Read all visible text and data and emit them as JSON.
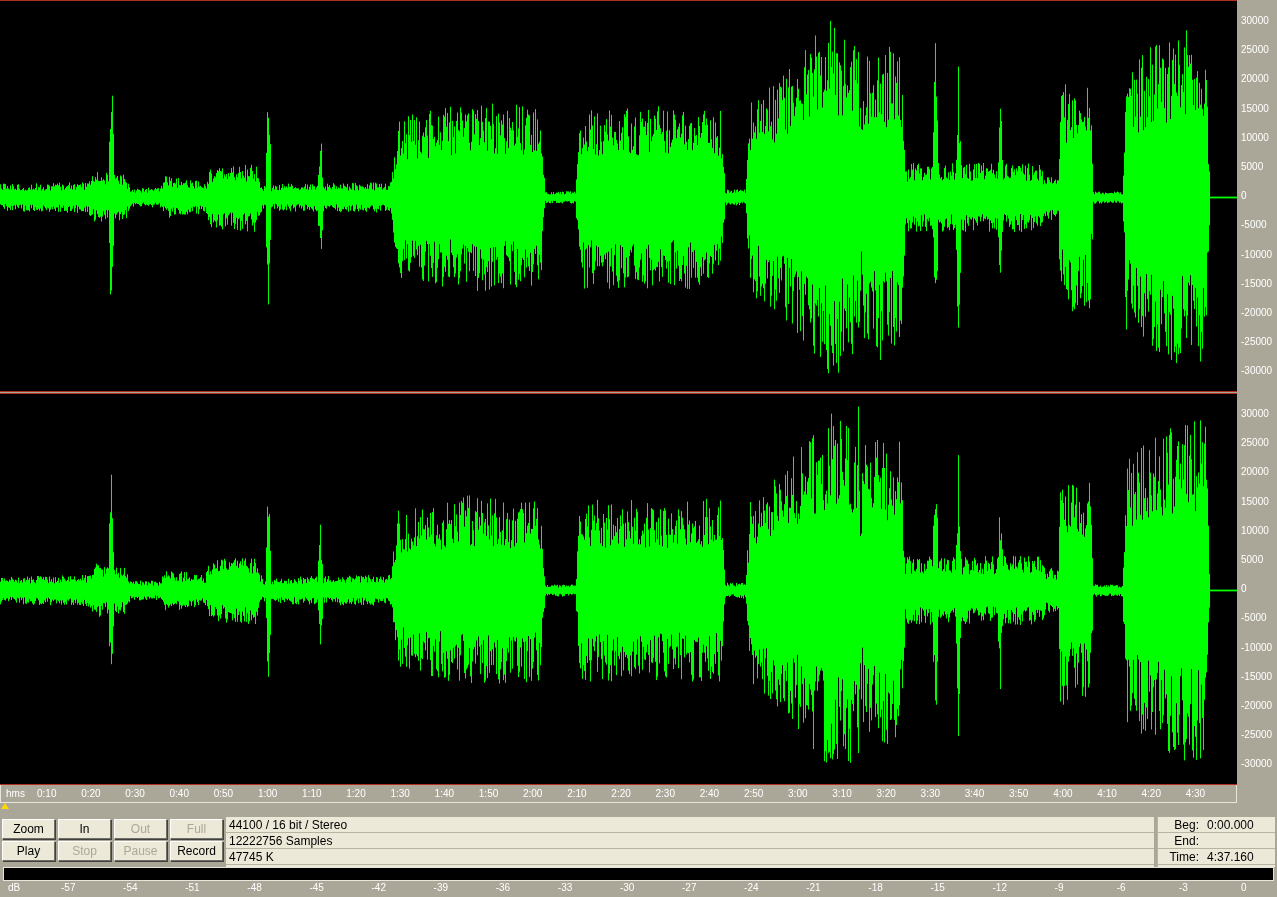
{
  "channels": [
    {
      "amplitude_ticks": [
        "30000",
        "25000",
        "20000",
        "15000",
        "10000",
        "5000",
        "0",
        "-5000",
        "-10000",
        "-15000",
        "-20000",
        "-25000",
        "-30000"
      ]
    },
    {
      "amplitude_ticks": [
        "30000",
        "25000",
        "20000",
        "15000",
        "10000",
        "5000",
        "0",
        "-5000",
        "-10000",
        "-15000",
        "-20000",
        "-25000",
        "-30000"
      ]
    }
  ],
  "time_ruler": {
    "unit": "hms",
    "ticks": [
      "0:10",
      "0:20",
      "0:30",
      "0:40",
      "0:50",
      "1:00",
      "1:10",
      "1:20",
      "1:30",
      "1:40",
      "1:50",
      "2:00",
      "2:10",
      "2:20",
      "2:30",
      "2:40",
      "2:50",
      "3:00",
      "3:10",
      "3:20",
      "3:30",
      "3:40",
      "3:50",
      "4:00",
      "4:10",
      "4:20",
      "4:30"
    ]
  },
  "transport_buttons": [
    {
      "label": "Zoom",
      "disabled": false
    },
    {
      "label": "In",
      "disabled": false
    },
    {
      "label": "Out",
      "disabled": true
    },
    {
      "label": "Full",
      "disabled": true
    },
    {
      "label": "Play",
      "disabled": false
    },
    {
      "label": "Stop",
      "disabled": true
    },
    {
      "label": "Pause",
      "disabled": true
    },
    {
      "label": "Record",
      "disabled": false
    }
  ],
  "file_info": [
    "44100 / 16 bit / Stereo",
    "12222756 Samples",
    "47745 K"
  ],
  "selection": [
    {
      "label": "Beg:",
      "value": "0:00.000"
    },
    {
      "label": "End:"
    },
    {
      "label": "Time:",
      "value": "4:37.160"
    }
  ],
  "level_meter": {
    "unit": "dB",
    "ticks": [
      "-57",
      "-54",
      "-51",
      "-48",
      "-45",
      "-42",
      "-39",
      "-36",
      "-33",
      "-30",
      "-27",
      "-24",
      "-21",
      "-18",
      "-15",
      "-12",
      "-9",
      "-6",
      "-3",
      "0"
    ]
  }
}
